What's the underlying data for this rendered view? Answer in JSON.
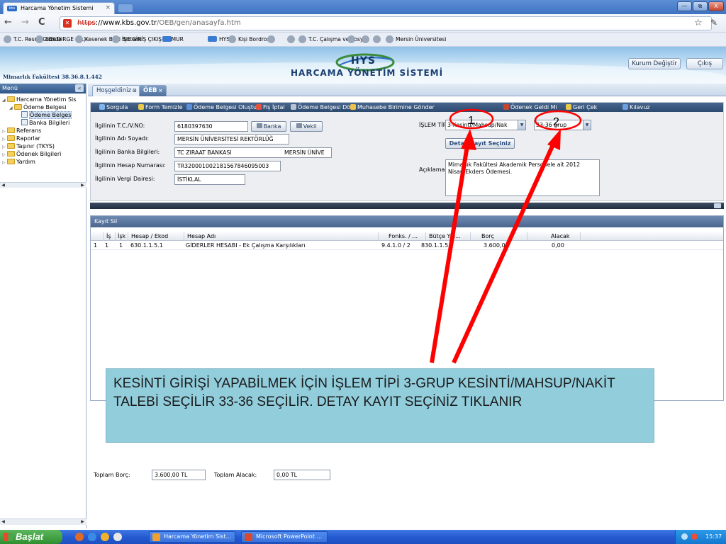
{
  "browser": {
    "tab_title": "Harcama Yönetim Sistemi",
    "tab_close": "×",
    "url_scheme": "https",
    "url_host": "://www.kbs.gov.tr",
    "url_path": "/OEB/gen/anasayfa.htm",
    "window_min": "—",
    "window_restore": "⧉",
    "window_close": "X",
    "back": "←",
    "forward": "→",
    "reload": "C",
    "bookmarks": [
      {
        "label": "T.C. Resmi Gazete"
      },
      {
        "label": "EBILDIRGE (TL)"
      },
      {
        "label": "Kesenek Bilgi Sistemi"
      },
      {
        "label": "İŞE GİRİŞ ÇIKIŞ MEMUR"
      },
      {
        "label": ""
      },
      {
        "label": "HYS"
      },
      {
        "label": "Kişi Bordrosu"
      },
      {
        "label": ""
      },
      {
        "label": ""
      },
      {
        "label": "T.C. Çalışma ve Sosy..."
      },
      {
        "label": ""
      },
      {
        "label": ""
      },
      {
        "label": ""
      },
      {
        "label": "Mersin Üniversitesi"
      }
    ]
  },
  "header": {
    "logo_text": "HYS",
    "app_title": "HARCAMA YÖNETİM SİSTEMİ",
    "version": "Mimarlık Fakültesi 38.36.8.1.442",
    "kurum_button": "Kurum Değiştir",
    "cikis_button": "Çıkış"
  },
  "sidebar": {
    "title": "Menü",
    "collapse": "«",
    "items": [
      {
        "label": "Harcama Yönetim Sis",
        "level": 0,
        "kind": "folder",
        "arrow": "◢"
      },
      {
        "label": "Ödeme Belgesi",
        "level": 1,
        "kind": "folder",
        "arrow": "◢"
      },
      {
        "label": "Ödeme Belges",
        "level": 2,
        "kind": "doc",
        "arrow": ""
      },
      {
        "label": "Banka Bilgileri",
        "level": 2,
        "kind": "doc",
        "arrow": ""
      },
      {
        "label": "Referans",
        "level": 0,
        "kind": "folder",
        "arrow": "▷"
      },
      {
        "label": "Raporlar",
        "level": 0,
        "kind": "folder",
        "arrow": "▷"
      },
      {
        "label": "Taşınır (TKYS)",
        "level": 0,
        "kind": "folder",
        "arrow": "▷"
      },
      {
        "label": "Ödenek Bilgileri",
        "level": 0,
        "kind": "folder",
        "arrow": "▷"
      },
      {
        "label": "Yardım",
        "level": 0,
        "kind": "folder",
        "arrow": "▷"
      }
    ]
  },
  "tabs": [
    {
      "label": "Hoşgeldiniz",
      "close": "⊠"
    },
    {
      "label": "ÖEB",
      "close": "×"
    }
  ],
  "toolbar": [
    {
      "label": "Sorgula",
      "color": "#7fb4ec"
    },
    {
      "label": "Form Temizle",
      "color": "#e9c94a"
    },
    {
      "label": "Ödeme Belgesi Oluştur",
      "color": "#5b8fd9"
    },
    {
      "label": "Fiş İptal",
      "color": "#e2533d"
    },
    {
      "label": "Ödeme Belgesi Dök",
      "color": "#b8c4d2"
    },
    {
      "label": "Muhasebe Birimine Gönder",
      "color": "#f0c24a"
    },
    {
      "label": "Ödenek Geldi Mi",
      "color": "#c9462c"
    },
    {
      "label": "Geri Çek",
      "color": "#e9c94a"
    },
    {
      "label": "Kılavuz",
      "color": "#6ea0e0"
    }
  ],
  "form": {
    "tc_label": "İlgilinin T.C./V.NO:",
    "tc_value": "6180397630",
    "banka_button": "Banka",
    "vekil_button": "Vekil",
    "ad_label": "İlgilinin Adı Soyadı:",
    "ad_value": "MERSİN ÜNİVERSİTESİ REKTÖRLÜĞ",
    "banka_label": "İlgilinin Banka Bilgileri:",
    "banka_value": "TC ZIRAAT BANKASI",
    "banka_value2": "MERSİN ÜNİVE",
    "hesap_label": "İlgilinin Hesap Numarası:",
    "hesap_value": "TR320001002181567846095003",
    "vergi_label": "İlgilinin Vergi Dairesi:",
    "vergi_value": "İSTİKLAL",
    "islem_label": "İŞLEM TİPİ:",
    "islem_value": "3-Kesinti/Mahsup/Nak",
    "grup_value": "33-36 grup",
    "dropdown_arrow": "▼",
    "detay_button": "Detay Kayıt Seçiniz",
    "aciklama_label": "Açıklama:",
    "aciklama_value": "Mimarlık Fakültesi Akademik Personele ait 2012 Nisan Ekders Ödemesi."
  },
  "grid": {
    "title": "Kayıt Sil",
    "headers": [
      "İş",
      "İşk",
      "Hesap / Ekod",
      "Hesap Adı",
      "Fonks. / ...",
      "Bütçe Yılı...",
      "Borç",
      "Alacak"
    ],
    "rows": [
      {
        "no": "1",
        "is": "1",
        "isk": "1",
        "hesap": "630.1.1.5.1",
        "ad": "GİDERLER HESABI - Ek Çalışma Karşılıkları",
        "fonks": "9.4.1.0 / 2",
        "butce": "830.1.1.5",
        "borc": "3.600,00",
        "alacak": "0,00"
      }
    ],
    "toplam_borc_label": "Toplam Borç:",
    "toplam_borc_value": "3.600,00 TL",
    "toplam_alacak_label": "Toplam Alacak:",
    "toplam_alacak_value": "0,00 TL"
  },
  "annotation": {
    "text": "KESİNTİ GİRİŞİ YAPABİLMEK İÇİN İŞLEM TİPİ 3-GRUP KESİNTİ/MAHSUP/NAKİT TALEBİ SEÇİLİR   33-36  SEÇİLİR. DETAY KAYIT SEÇİNİZ TIKLANIR",
    "marker1": "1",
    "marker2": "2",
    "arrow_color": "#ff0000"
  },
  "taskbar": {
    "start": "Başlat",
    "tasks": [
      {
        "label": "Harcama Yönetim Sist...",
        "color": "#f0a030"
      },
      {
        "label": "Microsoft PowerPoint ...",
        "color": "#d84a2b"
      }
    ],
    "clock": "15:37"
  }
}
